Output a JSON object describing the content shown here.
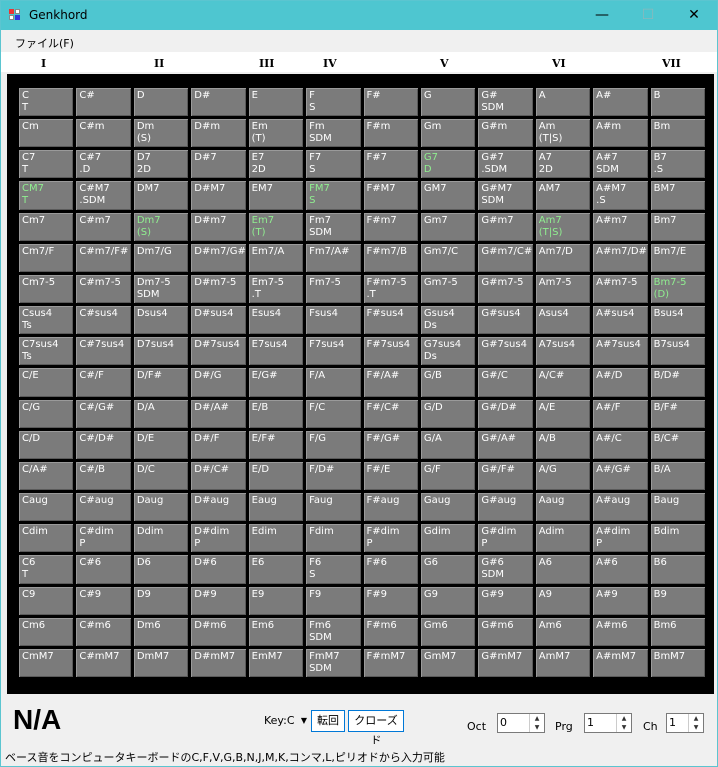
{
  "window": {
    "title": "Genkhord",
    "minimize": "—",
    "maximize": "☐",
    "close": "✕"
  },
  "menu": {
    "file": "ファイル(F)"
  },
  "numerals": [
    "I",
    "II",
    "III",
    "IV",
    "V",
    "VI",
    "VII"
  ],
  "grid": {
    "columns": 12,
    "rows": [
      [
        {
          "t": "C\nT"
        },
        {
          "t": "C#"
        },
        {
          "t": "D"
        },
        {
          "t": "D#"
        },
        {
          "t": "E"
        },
        {
          "t": "F\nS"
        },
        {
          "t": "F#"
        },
        {
          "t": "G"
        },
        {
          "t": "G#\nSDM"
        },
        {
          "t": "A"
        },
        {
          "t": "A#"
        },
        {
          "t": "B"
        }
      ],
      [
        {
          "t": "Cm"
        },
        {
          "t": "C#m"
        },
        {
          "t": "Dm\n(S)"
        },
        {
          "t": "D#m"
        },
        {
          "t": "Em\n(T)"
        },
        {
          "t": "Fm\nSDM"
        },
        {
          "t": "F#m"
        },
        {
          "t": "Gm"
        },
        {
          "t": "G#m"
        },
        {
          "t": "Am\n(T|S)"
        },
        {
          "t": "A#m"
        },
        {
          "t": "Bm"
        }
      ],
      [
        {
          "t": "C7\nT"
        },
        {
          "t": "C#7\n.D"
        },
        {
          "t": "D7\n2D"
        },
        {
          "t": "D#7"
        },
        {
          "t": "E7\n2D"
        },
        {
          "t": "F7\nS"
        },
        {
          "t": "F#7"
        },
        {
          "t": "G7\nD",
          "g": true
        },
        {
          "t": "G#7\n.SDM"
        },
        {
          "t": "A7\n2D"
        },
        {
          "t": "A#7\nSDM"
        },
        {
          "t": "B7\n.S"
        }
      ],
      [
        {
          "t": "CM7\nT",
          "g": true
        },
        {
          "t": "C#M7\n.SDM"
        },
        {
          "t": "DM7"
        },
        {
          "t": "D#M7"
        },
        {
          "t": "EM7"
        },
        {
          "t": "FM7\nS",
          "g": true
        },
        {
          "t": "F#M7"
        },
        {
          "t": "GM7"
        },
        {
          "t": "G#M7\nSDM"
        },
        {
          "t": "AM7"
        },
        {
          "t": "A#M7\n.S"
        },
        {
          "t": "BM7"
        }
      ],
      [
        {
          "t": "Cm7"
        },
        {
          "t": "C#m7"
        },
        {
          "t": "Dm7\n(S)",
          "g": true
        },
        {
          "t": "D#m7"
        },
        {
          "t": "Em7\n(T)",
          "g": true
        },
        {
          "t": "Fm7\nSDM"
        },
        {
          "t": "F#m7"
        },
        {
          "t": "Gm7"
        },
        {
          "t": "G#m7"
        },
        {
          "t": "Am7\n(T|S)",
          "g": true
        },
        {
          "t": "A#m7"
        },
        {
          "t": "Bm7"
        }
      ],
      [
        {
          "t": "Cm7/F"
        },
        {
          "t": "C#m7/F#"
        },
        {
          "t": "Dm7/G"
        },
        {
          "t": "D#m7/G#"
        },
        {
          "t": "Em7/A"
        },
        {
          "t": "Fm7/A#"
        },
        {
          "t": "F#m7/B"
        },
        {
          "t": "Gm7/C"
        },
        {
          "t": "G#m7/C#"
        },
        {
          "t": "Am7/D"
        },
        {
          "t": "A#m7/D#"
        },
        {
          "t": "Bm7/E"
        }
      ],
      [
        {
          "t": "Cm7-5"
        },
        {
          "t": "C#m7-5"
        },
        {
          "t": "Dm7-5\nSDM"
        },
        {
          "t": "D#m7-5"
        },
        {
          "t": "Em7-5\n.T"
        },
        {
          "t": "Fm7-5"
        },
        {
          "t": "F#m7-5\n.T"
        },
        {
          "t": "Gm7-5"
        },
        {
          "t": "G#m7-5"
        },
        {
          "t": "Am7-5"
        },
        {
          "t": "A#m7-5"
        },
        {
          "t": "Bm7-5\n(D)",
          "g": true
        }
      ],
      [
        {
          "t": "Csus4\nTs"
        },
        {
          "t": "C#sus4"
        },
        {
          "t": "Dsus4"
        },
        {
          "t": "D#sus4"
        },
        {
          "t": "Esus4"
        },
        {
          "t": "Fsus4"
        },
        {
          "t": "F#sus4"
        },
        {
          "t": "Gsus4\nDs"
        },
        {
          "t": "G#sus4"
        },
        {
          "t": "Asus4"
        },
        {
          "t": "A#sus4"
        },
        {
          "t": "Bsus4"
        }
      ],
      [
        {
          "t": "C7sus4\nTs"
        },
        {
          "t": "C#7sus4"
        },
        {
          "t": "D7sus4"
        },
        {
          "t": "D#7sus4"
        },
        {
          "t": "E7sus4"
        },
        {
          "t": "F7sus4"
        },
        {
          "t": "F#7sus4"
        },
        {
          "t": "G7sus4\nDs"
        },
        {
          "t": "G#7sus4"
        },
        {
          "t": "A7sus4"
        },
        {
          "t": "A#7sus4"
        },
        {
          "t": "B7sus4"
        }
      ],
      [
        {
          "t": "C/E"
        },
        {
          "t": "C#/F"
        },
        {
          "t": "D/F#"
        },
        {
          "t": "D#/G"
        },
        {
          "t": "E/G#"
        },
        {
          "t": "F/A"
        },
        {
          "t": "F#/A#"
        },
        {
          "t": "G/B"
        },
        {
          "t": "G#/C"
        },
        {
          "t": "A/C#"
        },
        {
          "t": "A#/D"
        },
        {
          "t": "B/D#"
        }
      ],
      [
        {
          "t": "C/G"
        },
        {
          "t": "C#/G#"
        },
        {
          "t": "D/A"
        },
        {
          "t": "D#/A#"
        },
        {
          "t": "E/B"
        },
        {
          "t": "F/C"
        },
        {
          "t": "F#/C#"
        },
        {
          "t": "G/D"
        },
        {
          "t": "G#/D#"
        },
        {
          "t": "A/E"
        },
        {
          "t": "A#/F"
        },
        {
          "t": "B/F#"
        }
      ],
      [
        {
          "t": "C/D"
        },
        {
          "t": "C#/D#"
        },
        {
          "t": "D/E"
        },
        {
          "t": "D#/F"
        },
        {
          "t": "E/F#"
        },
        {
          "t": "F/G"
        },
        {
          "t": "F#/G#"
        },
        {
          "t": "G/A"
        },
        {
          "t": "G#/A#"
        },
        {
          "t": "A/B"
        },
        {
          "t": "A#/C"
        },
        {
          "t": "B/C#"
        }
      ],
      [
        {
          "t": "C/A#"
        },
        {
          "t": "C#/B"
        },
        {
          "t": "D/C"
        },
        {
          "t": "D#/C#"
        },
        {
          "t": "E/D"
        },
        {
          "t": "F/D#"
        },
        {
          "t": "F#/E"
        },
        {
          "t": "G/F"
        },
        {
          "t": "G#/F#"
        },
        {
          "t": "A/G"
        },
        {
          "t": "A#/G#"
        },
        {
          "t": "B/A"
        }
      ],
      [
        {
          "t": "Caug"
        },
        {
          "t": "C#aug"
        },
        {
          "t": "Daug"
        },
        {
          "t": "D#aug"
        },
        {
          "t": "Eaug"
        },
        {
          "t": "Faug"
        },
        {
          "t": "F#aug"
        },
        {
          "t": "Gaug"
        },
        {
          "t": "G#aug"
        },
        {
          "t": "Aaug"
        },
        {
          "t": "A#aug"
        },
        {
          "t": "Baug"
        }
      ],
      [
        {
          "t": "Cdim"
        },
        {
          "t": "C#dim\nP"
        },
        {
          "t": "Ddim"
        },
        {
          "t": "D#dim\nP"
        },
        {
          "t": "Edim"
        },
        {
          "t": "Fdim"
        },
        {
          "t": "F#dim\nP"
        },
        {
          "t": "Gdim"
        },
        {
          "t": "G#dim\nP"
        },
        {
          "t": "Adim"
        },
        {
          "t": "A#dim\nP"
        },
        {
          "t": "Bdim"
        }
      ],
      [
        {
          "t": "C6\nT"
        },
        {
          "t": "C#6"
        },
        {
          "t": "D6"
        },
        {
          "t": "D#6"
        },
        {
          "t": "E6"
        },
        {
          "t": "F6\nS"
        },
        {
          "t": "F#6"
        },
        {
          "t": "G6"
        },
        {
          "t": "G#6\nSDM"
        },
        {
          "t": "A6"
        },
        {
          "t": "A#6"
        },
        {
          "t": "B6"
        }
      ],
      [
        {
          "t": "C9"
        },
        {
          "t": "C#9"
        },
        {
          "t": "D9"
        },
        {
          "t": "D#9"
        },
        {
          "t": "E9"
        },
        {
          "t": "F9"
        },
        {
          "t": "F#9"
        },
        {
          "t": "G9"
        },
        {
          "t": "G#9"
        },
        {
          "t": "A9"
        },
        {
          "t": "A#9"
        },
        {
          "t": "B9"
        }
      ],
      [
        {
          "t": "Cm6"
        },
        {
          "t": "C#m6"
        },
        {
          "t": "Dm6"
        },
        {
          "t": "D#m6"
        },
        {
          "t": "Em6"
        },
        {
          "t": "Fm6\nSDM"
        },
        {
          "t": "F#m6"
        },
        {
          "t": "Gm6"
        },
        {
          "t": "G#m6"
        },
        {
          "t": "Am6"
        },
        {
          "t": "A#m6"
        },
        {
          "t": "Bm6"
        }
      ],
      [
        {
          "t": "CmM7"
        },
        {
          "t": "C#mM7"
        },
        {
          "t": "DmM7"
        },
        {
          "t": "D#mM7"
        },
        {
          "t": "EmM7"
        },
        {
          "t": "FmM7\nSDM"
        },
        {
          "t": "F#mM7"
        },
        {
          "t": "GmM7"
        },
        {
          "t": "G#mM7"
        },
        {
          "t": "AmM7"
        },
        {
          "t": "A#mM7"
        },
        {
          "t": "BmM7"
        }
      ]
    ]
  },
  "bottom": {
    "chord_name": "N/A",
    "key_select": "Key:C",
    "transpose_button": "転回",
    "closed_button": "クローズド",
    "oct_label": "Oct",
    "oct_value": "0",
    "prg_label": "Prg",
    "prg_value": "1",
    "ch_label": "Ch",
    "ch_value": "1"
  },
  "status": {
    "text": "ベース音をコンピュータキーボードのC,F,V,G,B,N,J,M,K,コンマ,L,ピリオドから入力可能"
  },
  "colors": {
    "titlebar": "#4ec6d0",
    "cell_bg": "#7b7b7b",
    "highlight_text": "#90ee90"
  }
}
